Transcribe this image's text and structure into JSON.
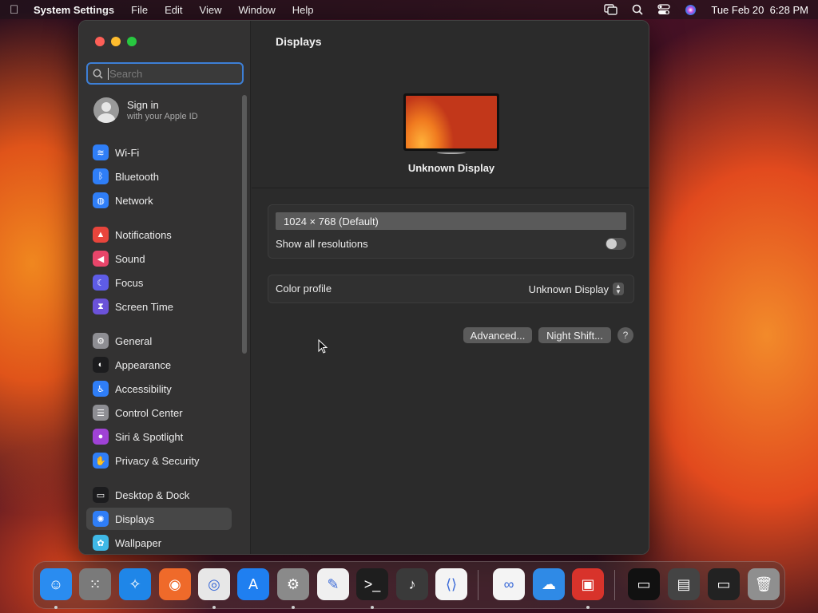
{
  "menubar": {
    "app": "System Settings",
    "menus": [
      "File",
      "Edit",
      "View",
      "Window",
      "Help"
    ],
    "clock": "Tue Feb 20  6:28 PM",
    "icons": [
      "apple-icon",
      "screen-mirroring-icon",
      "spotlight-search-icon",
      "control-center-icon",
      "siri-icon"
    ]
  },
  "sidebar": {
    "search_placeholder": "Search",
    "signin": {
      "title": "Sign in",
      "subtitle": "with your Apple ID"
    },
    "items": [
      {
        "label": "Wi-Fi",
        "icon": "wifi-icon",
        "color": "#2f7ef7",
        "glyph": "≋"
      },
      {
        "label": "Bluetooth",
        "icon": "bluetooth-icon",
        "color": "#2f7ef7",
        "glyph": "ᛒ"
      },
      {
        "label": "Network",
        "icon": "globe-icon",
        "color": "#2f7ef7",
        "glyph": "◍"
      },
      {
        "label": "Notifications",
        "icon": "bell-icon",
        "color": "#e8453c",
        "glyph": "▲"
      },
      {
        "label": "Sound",
        "icon": "speaker-icon",
        "color": "#e8456a",
        "glyph": "◀"
      },
      {
        "label": "Focus",
        "icon": "moon-icon",
        "color": "#5e5ce6",
        "glyph": "☾"
      },
      {
        "label": "Screen Time",
        "icon": "hourglass-icon",
        "color": "#6b52d9",
        "glyph": "⧗"
      },
      {
        "label": "General",
        "icon": "gear-icon",
        "color": "#8e8e93",
        "glyph": "⚙"
      },
      {
        "label": "Appearance",
        "icon": "appearance-icon",
        "color": "#1c1c1e",
        "glyph": "◐"
      },
      {
        "label": "Accessibility",
        "icon": "accessibility-icon",
        "color": "#2f7ef7",
        "glyph": "♿"
      },
      {
        "label": "Control Center",
        "icon": "toggles-icon",
        "color": "#8e8e93",
        "glyph": "☰"
      },
      {
        "label": "Siri & Spotlight",
        "icon": "siri-icon",
        "color": "#a042d6",
        "glyph": "●"
      },
      {
        "label": "Privacy & Security",
        "icon": "hand-icon",
        "color": "#2f7ef7",
        "glyph": "✋"
      },
      {
        "label": "Desktop & Dock",
        "icon": "dock-icon",
        "color": "#1c1c1e",
        "glyph": "▭"
      },
      {
        "label": "Displays",
        "icon": "sun-icon",
        "color": "#2f7ef7",
        "glyph": "✺"
      },
      {
        "label": "Wallpaper",
        "icon": "flower-icon",
        "color": "#3fb8e6",
        "glyph": "✿"
      }
    ]
  },
  "main": {
    "title": "Displays",
    "display_name": "Unknown Display",
    "resolution": "1024 × 768 (Default)",
    "show_all_label": "Show all resolutions",
    "show_all_enabled": false,
    "color_profile_label": "Color profile",
    "color_profile_value": "Unknown Display",
    "advanced_label": "Advanced...",
    "night_shift_label": "Night Shift...",
    "help_label": "?"
  },
  "dock": {
    "apps": [
      {
        "name": "finder-icon",
        "color": "#2a8cf0",
        "glyph": "☺",
        "running": true
      },
      {
        "name": "launchpad-icon",
        "color": "#7a7a7a",
        "glyph": "⁙",
        "running": false
      },
      {
        "name": "safari-icon",
        "color": "#1f86e8",
        "glyph": "✧",
        "running": false
      },
      {
        "name": "firefox-icon",
        "color": "#ef6a2a",
        "glyph": "◉",
        "running": false
      },
      {
        "name": "chrome-icon",
        "color": "#e7e7e7",
        "glyph": "◎",
        "running": true
      },
      {
        "name": "app-store-icon",
        "color": "#1f7ff0",
        "glyph": "A",
        "running": false
      },
      {
        "name": "system-settings-icon",
        "color": "#8a8a8a",
        "glyph": "⚙",
        "running": true
      },
      {
        "name": "textedit-icon",
        "color": "#f0f0f0",
        "glyph": "✎",
        "running": false
      },
      {
        "name": "terminal-icon",
        "color": "#1e1e1e",
        "glyph": ">_",
        "running": true
      },
      {
        "name": "garageband-icon",
        "color": "#3a3a3a",
        "glyph": "♪",
        "running": false
      },
      {
        "name": "vscode-icon",
        "color": "#f4f4f4",
        "glyph": "⟨⟩",
        "running": false
      },
      {
        "name": "visual-studio-icon",
        "color": "#f4f4f4",
        "glyph": "∞",
        "running": false
      },
      {
        "name": "weather-icon",
        "color": "#2f8ae6",
        "glyph": "☁",
        "running": false
      },
      {
        "name": "photo-booth-icon",
        "color": "#d8332b",
        "glyph": "▣",
        "running": true
      },
      {
        "name": "preview-window-icon",
        "color": "#111111",
        "glyph": "▭",
        "running": false
      },
      {
        "name": "apps-folder-icon",
        "color": "#444444",
        "glyph": "▤",
        "running": false
      },
      {
        "name": "window-thumbnail-icon",
        "color": "#222222",
        "glyph": "▭",
        "running": false
      },
      {
        "name": "trash-icon",
        "color": "#8f8f8f",
        "glyph": "🗑",
        "running": false
      }
    ]
  }
}
